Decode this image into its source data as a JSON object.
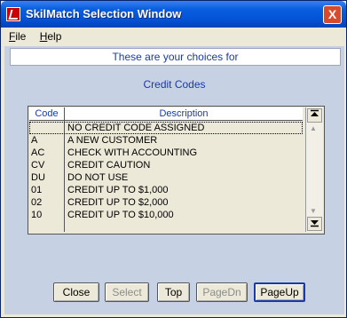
{
  "window": {
    "title": "SkilMatch Selection Window",
    "close_glyph": "X"
  },
  "menu": [
    {
      "label": "File",
      "underline": "F"
    },
    {
      "label": "Help",
      "underline": "H"
    }
  ],
  "banner": "These are your choices for",
  "subtitle": "Credit Codes",
  "grid": {
    "headers": {
      "code": "Code",
      "description": "Description"
    },
    "rows": [
      {
        "code": "",
        "description": "NO CREDIT CODE ASSIGNED"
      },
      {
        "code": "A",
        "description": "A NEW CUSTOMER"
      },
      {
        "code": "AC",
        "description": "CHECK WITH ACCOUNTING"
      },
      {
        "code": "CV",
        "description": "CREDIT CAUTION"
      },
      {
        "code": "DU",
        "description": "DO NOT USE"
      },
      {
        "code": "01",
        "description": "CREDIT UP TO $1,000"
      },
      {
        "code": "02",
        "description": "CREDIT UP TO $2,000"
      },
      {
        "code": "10",
        "description": "CREDIT UP TO $10,000"
      }
    ]
  },
  "buttons": {
    "close": "Close",
    "select": "Select",
    "top": "Top",
    "pagedn": "PageDn",
    "pageup": "PageUp"
  }
}
